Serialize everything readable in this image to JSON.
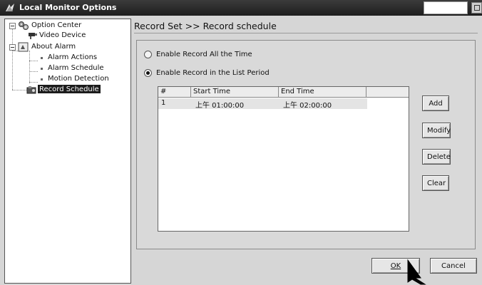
{
  "window": {
    "title": "Local Monitor Options"
  },
  "tree": {
    "items": [
      {
        "label": "Option Center"
      },
      {
        "label": "Video Device"
      },
      {
        "label": "About Alarm"
      },
      {
        "label": "Alarm Actions"
      },
      {
        "label": "Alarm Schedule"
      },
      {
        "label": "Motion Detection"
      },
      {
        "label": "Record Schedule"
      }
    ]
  },
  "main": {
    "heading": "Record Set >> Record schedule",
    "options": [
      {
        "label": "Enable Record All the Time",
        "checked": false
      },
      {
        "label": "Enable Record in the List Period",
        "checked": true
      }
    ],
    "table": {
      "columns": [
        "#",
        "Start Time",
        "End Time"
      ],
      "rows": [
        {
          "num": "1",
          "start": "上午 01:00:00",
          "end": "上午 02:00:00"
        }
      ]
    },
    "side_buttons": {
      "add": "Add",
      "modify": "Modify",
      "delete": "Delete",
      "clear": "Clear"
    }
  },
  "footer": {
    "ok_label": "OK",
    "cancel_label": "Cancel"
  },
  "colors": {
    "titlebar": "#2a2a2a",
    "selection": "#1c1c1c",
    "window_bg": "#d6d6d6"
  }
}
